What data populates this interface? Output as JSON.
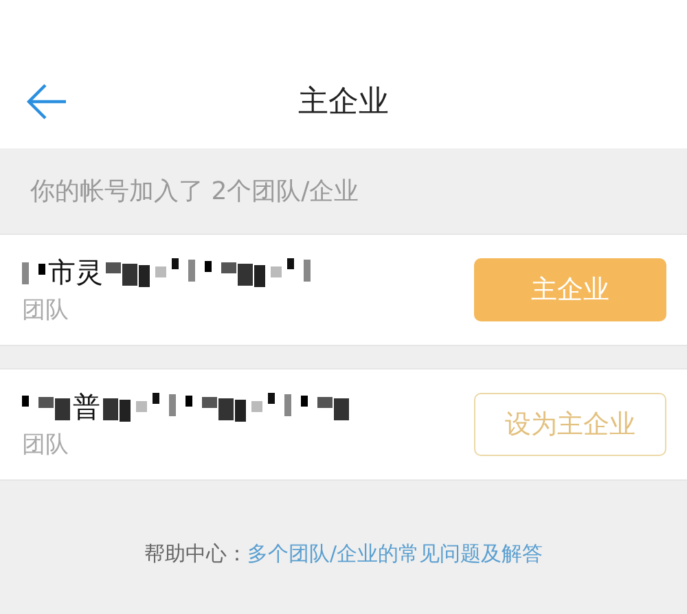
{
  "header": {
    "title": "主企业"
  },
  "notice": "你的帐号加入了 2个团队/企业",
  "teams": [
    {
      "name": "市灵",
      "type": "团队",
      "button": "主企业",
      "selected": true
    },
    {
      "name": "普",
      "type": "团队",
      "button": "设为主企业",
      "selected": false
    }
  ],
  "help": {
    "label": "帮助中心：",
    "link": "多个团队/企业的常见问题及解答"
  }
}
